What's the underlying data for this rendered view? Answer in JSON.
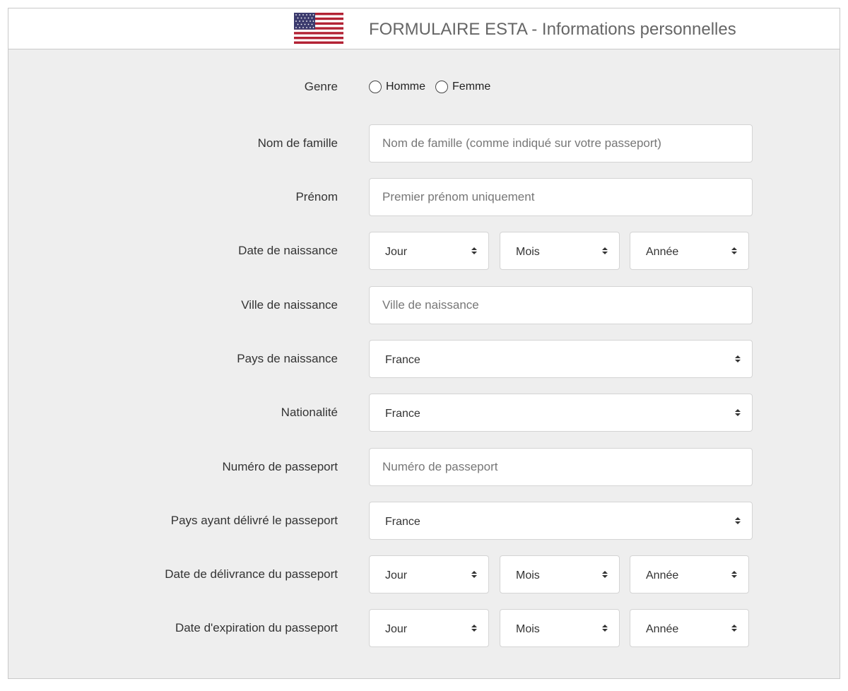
{
  "header": {
    "title": "FORMULAIRE ESTA - Informations personnelles",
    "flag_icon": "us-flag-icon"
  },
  "colors": {
    "panel_bg": "#eeeeee",
    "border": "#c9c9c9",
    "flag_red": "#b22234",
    "flag_blue": "#3c3b6e"
  },
  "form": {
    "gender": {
      "label": "Genre",
      "options": [
        "Homme",
        "Femme"
      ],
      "selected": null
    },
    "last_name": {
      "label": "Nom de famille",
      "value": "",
      "placeholder": "Nom de famille (comme indiqué sur votre passeport)"
    },
    "first_name": {
      "label": "Prénom",
      "value": "",
      "placeholder": "Premier prénom uniquement"
    },
    "birth_date": {
      "label": "Date de naissance",
      "day": "Jour",
      "month": "Mois",
      "year": "Année"
    },
    "birth_city": {
      "label": "Ville de naissance",
      "value": "",
      "placeholder": "Ville de naissance"
    },
    "birth_country": {
      "label": "Pays de naissance",
      "selected": "France"
    },
    "nationality": {
      "label": "Nationalité",
      "selected": "France"
    },
    "passport_number": {
      "label": "Numéro de passeport",
      "value": "",
      "placeholder": "Numéro de passeport"
    },
    "passport_country": {
      "label": "Pays ayant délivré le passeport",
      "selected": "France"
    },
    "passport_issue_date": {
      "label": "Date de délivrance du passeport",
      "day": "Jour",
      "month": "Mois",
      "year": "Année"
    },
    "passport_expiry_date": {
      "label": "Date d'expiration du passeport",
      "day": "Jour",
      "month": "Mois",
      "year": "Année"
    }
  }
}
